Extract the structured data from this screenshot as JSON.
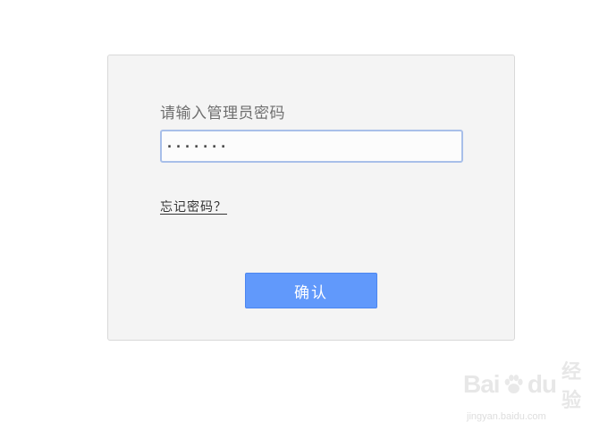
{
  "login": {
    "prompt": "请输入管理员密码",
    "password_value": "·······",
    "forgot_link": "忘记密码？",
    "confirm_label": "确认"
  },
  "watermark": {
    "brand_left": "Bai",
    "brand_right": "du",
    "brand_cn": "经验",
    "url": "jingyan.baidu.com"
  },
  "colors": {
    "button_bg": "#6199fb",
    "panel_bg": "#f4f4f4",
    "field_border": "#a8bfe9"
  }
}
